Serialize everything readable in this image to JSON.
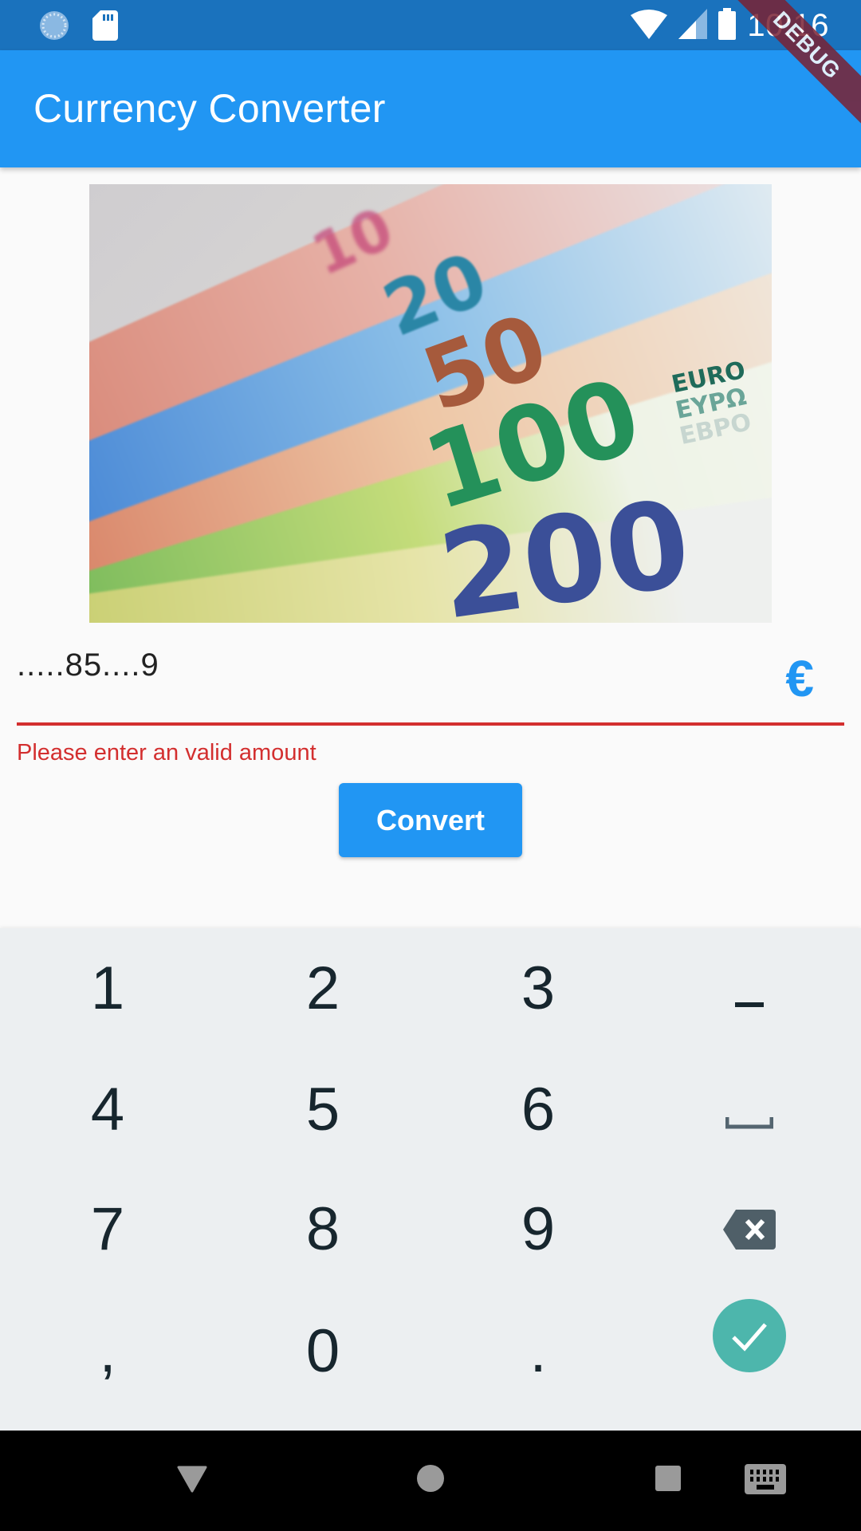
{
  "status_bar": {
    "time": "10:16",
    "icons": [
      "sync-icon",
      "sd-card-icon",
      "wifi-off-icon",
      "signal-icon",
      "battery-icon"
    ]
  },
  "app_bar": {
    "title": "Currency Converter"
  },
  "debug_banner": "DEBUG",
  "hero_image": {
    "alt": "Euro banknotes",
    "notes": [
      "10",
      "20",
      "50",
      "100",
      "200"
    ],
    "euro_text": [
      "EURO",
      "ΕΥΡΩ",
      "ЕВРО"
    ]
  },
  "amount_field": {
    "value": ".....85....9",
    "suffix_icon": "euro-icon",
    "suffix_symbol": "€",
    "error": "Please enter an valid amount",
    "colors": {
      "error": "#d32f2f",
      "accent": "#2196f3"
    }
  },
  "convert_button": {
    "label": "Convert"
  },
  "keyboard": {
    "rows": [
      [
        "1",
        "2",
        "3",
        "−"
      ],
      [
        "4",
        "5",
        "6",
        "space"
      ],
      [
        "7",
        "8",
        "9",
        "backspace"
      ],
      [
        ",",
        "0",
        ".",
        "done"
      ]
    ]
  },
  "nav_bar": {
    "buttons": [
      "back",
      "home",
      "recents",
      "keyboard-switch"
    ]
  },
  "colors": {
    "status_bar": "#1a72bd",
    "app_bar": "#2196f3",
    "keyboard_bg": "#eceff1",
    "done_key": "#4db6ac"
  }
}
